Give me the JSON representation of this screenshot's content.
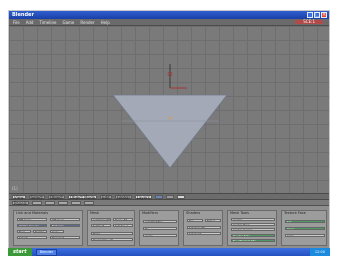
{
  "window": {
    "title": "Blender"
  },
  "menubar": {
    "items": [
      "File",
      "Add",
      "Timeline",
      "Game",
      "Render",
      "Help"
    ],
    "scene": "SCE:1"
  },
  "viewport": {
    "label": "(1)",
    "shape": "inverted-triangle",
    "face_color": "#a3a9b6",
    "edge_color": "#707888"
  },
  "view_header": {
    "buttons": [
      "View",
      "Select",
      "Object",
      "Object Mode",
      "Edit",
      "Global",
      "Layers",
      "",
      "",
      ""
    ]
  },
  "buttons_header": {
    "buttons": [
      "Panels",
      "",
      "",
      "",
      "",
      ""
    ]
  },
  "panels": [
    {
      "title": "Link and Materials",
      "fields": [
        "ME:Cone",
        "OB:Cone",
        "Vertex Groups",
        "Material",
        "New",
        "Delete",
        "Copy",
        "Select",
        "Deselect"
      ]
    },
    {
      "title": "Mesh",
      "fields": [
        "AutoSmooth",
        "Degr: 30",
        "SubSurf",
        "Subdiv: 1",
        "Make",
        "Decimator: 10"
      ]
    },
    {
      "title": "Modifiers",
      "fields": [
        "Add Modifier",
        "To: ",
        "Apply"
      ]
    },
    {
      "title": "Shaders",
      "fields": [
        "Tex",
        "Edges",
        "Set Smooth",
        "Set Solid"
      ]
    },
    {
      "title": "Mesh Tools",
      "fields": [
        "Center",
        "Center New",
        "Center Cursor",
        "Double Side",
        "No V.Normal Flip"
      ]
    },
    {
      "title": "Texture Face",
      "fields": [
        "Set",
        "Clear",
        "Copy"
      ]
    }
  ],
  "taskbar": {
    "start": "start",
    "tasks": [
      "Blender"
    ],
    "clock": "12:00"
  },
  "colors": {
    "viewport_bg": "#7a7a7a",
    "titlebar": "#2350c0",
    "scene_field": "#b34a4a"
  }
}
